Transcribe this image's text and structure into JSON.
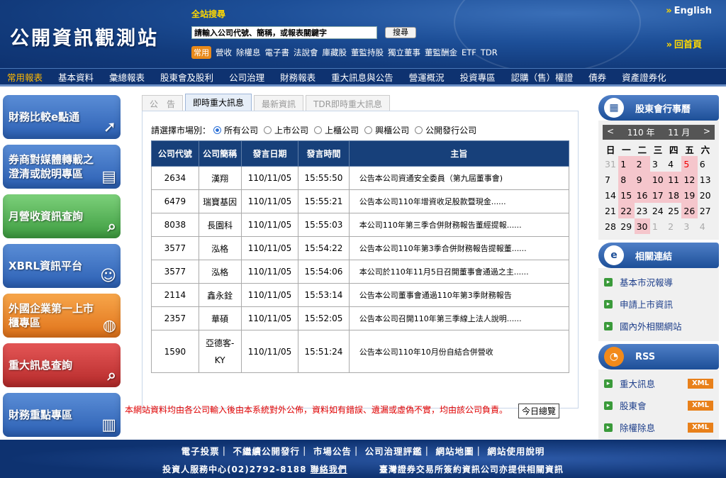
{
  "header": {
    "logo": "公開資訊觀測站",
    "search_title": "全站搜尋",
    "search_placeholder": "請輸入公司代號、簡稱，或報表關鍵字",
    "search_button": "搜尋",
    "quick_tag": "常用",
    "quick_links": [
      "營收",
      "除權息",
      "電子書",
      "法說會",
      "庫藏股",
      "董監持股",
      "獨立董事",
      "董監酬金",
      "ETF",
      "TDR"
    ],
    "english": "English",
    "home": "回首頁"
  },
  "nav": [
    "常用報表",
    "基本資料",
    "彙總報表",
    "股東會及股利",
    "公司治理",
    "財務報表",
    "重大訊息與公告",
    "營運概況",
    "投資專區",
    "認購（售）權證",
    "債券",
    "資產證券化"
  ],
  "left_banners": [
    {
      "label": "財務比較e點通",
      "icon": "cursor-icon"
    },
    {
      "label": "券商對媒體轉載之澄清或說明專區",
      "icon": "document-icon"
    },
    {
      "label": "月營收資訊查詢",
      "icon": "magnifier-chart-icon"
    },
    {
      "label": "XBRL資訊平台",
      "icon": "person-computer-icon"
    },
    {
      "label": "外國企業第一上市櫃專區",
      "icon": "globe-icon"
    },
    {
      "label": "重大訊息查詢",
      "icon": "magnifier-icon"
    },
    {
      "label": "財務重點專區",
      "icon": "bar-chart-icon"
    }
  ],
  "tabs": [
    "公　告",
    "即時重大訊息",
    "最新資訊",
    "TDR即時重大訊息"
  ],
  "market": {
    "label": "請選擇市場別：",
    "options": [
      "所有公司",
      "上市公司",
      "上櫃公司",
      "興櫃公司",
      "公開發行公司"
    ],
    "selected": 0
  },
  "table": {
    "headers": [
      "公司代號",
      "公司簡稱",
      "發言日期",
      "發言時間",
      "主旨"
    ],
    "rows": [
      [
        "2634",
        "漢翔",
        "110/11/05",
        "15:55:50",
        "公告本公司資通安全委員（第九屆董事會)"
      ],
      [
        "6479",
        "瑞寶基因",
        "110/11/05",
        "15:55:21",
        "公告本公司110年增資收足股款暨現金......"
      ],
      [
        "8038",
        "長園科",
        "110/11/05",
        "15:55:03",
        "本公司110年第三季合併財務報告董經提報......"
      ],
      [
        "3577",
        "泓格",
        "110/11/05",
        "15:54:22",
        "公告本公司110年第3季合併財務報告提報董......"
      ],
      [
        "3577",
        "泓格",
        "110/11/05",
        "15:54:06",
        "本公司於110年11月5日召開董事會通過之主......"
      ],
      [
        "2114",
        "鑫永銓",
        "110/11/05",
        "15:53:14",
        "公告本公司董事會通過110年第3季財務報告"
      ],
      [
        "2357",
        "華碩",
        "110/11/05",
        "15:52:05",
        "公告本公司召開110年第三季線上法人說明......"
      ],
      [
        "1590",
        "亞德客-KY",
        "110/11/05",
        "15:51:24",
        "公告本公司110年10月份自結合併營收"
      ]
    ],
    "daily_button": "今日總覽"
  },
  "disclaimer": "本網站資料均由各公司輸入後由本系統對外公佈，資料如有錯誤、遺漏或虛偽不實，均由該公司負責。",
  "calendar": {
    "title": "股東會行事曆",
    "prev": "<",
    "year": "110 年",
    "month": "11 月",
    "next": ">",
    "weekdays": [
      "日",
      "一",
      "二",
      "三",
      "四",
      "五",
      "六"
    ],
    "weeks": [
      [
        "31",
        "1",
        "2",
        "3",
        "4",
        "5",
        "6"
      ],
      [
        "7",
        "8",
        "9",
        "10",
        "11",
        "12",
        "13"
      ],
      [
        "14",
        "15",
        "16",
        "17",
        "18",
        "19",
        "20"
      ],
      [
        "21",
        "22",
        "23",
        "24",
        "25",
        "26",
        "27"
      ],
      [
        "28",
        "29",
        "30",
        "1",
        "2",
        "3",
        "4"
      ]
    ]
  },
  "related": {
    "title": "相關連結",
    "items": [
      "基本市況報導",
      "申請上市資訊",
      "國內外相關網站"
    ]
  },
  "rss": {
    "title": "RSS",
    "items": [
      "重大訊息",
      "股東會",
      "除權除息"
    ],
    "badge": "XML"
  },
  "footer": {
    "links": "電子投票｜ 不繼續公開發行｜ 市場公告｜ 公司治理評鑑｜ 網站地圖｜ 網站使用說明",
    "service": "投資人服務中心(02)2792-8188",
    "contact": "聯絡我們",
    "note": "臺灣證券交易所簽約資訊公司亦提供相關資訊"
  },
  "colors": {
    "header_bg": "#1d4f98",
    "nav_active": "#ffb800",
    "table_header": "#17407a",
    "disclaimer": "#e00000"
  }
}
